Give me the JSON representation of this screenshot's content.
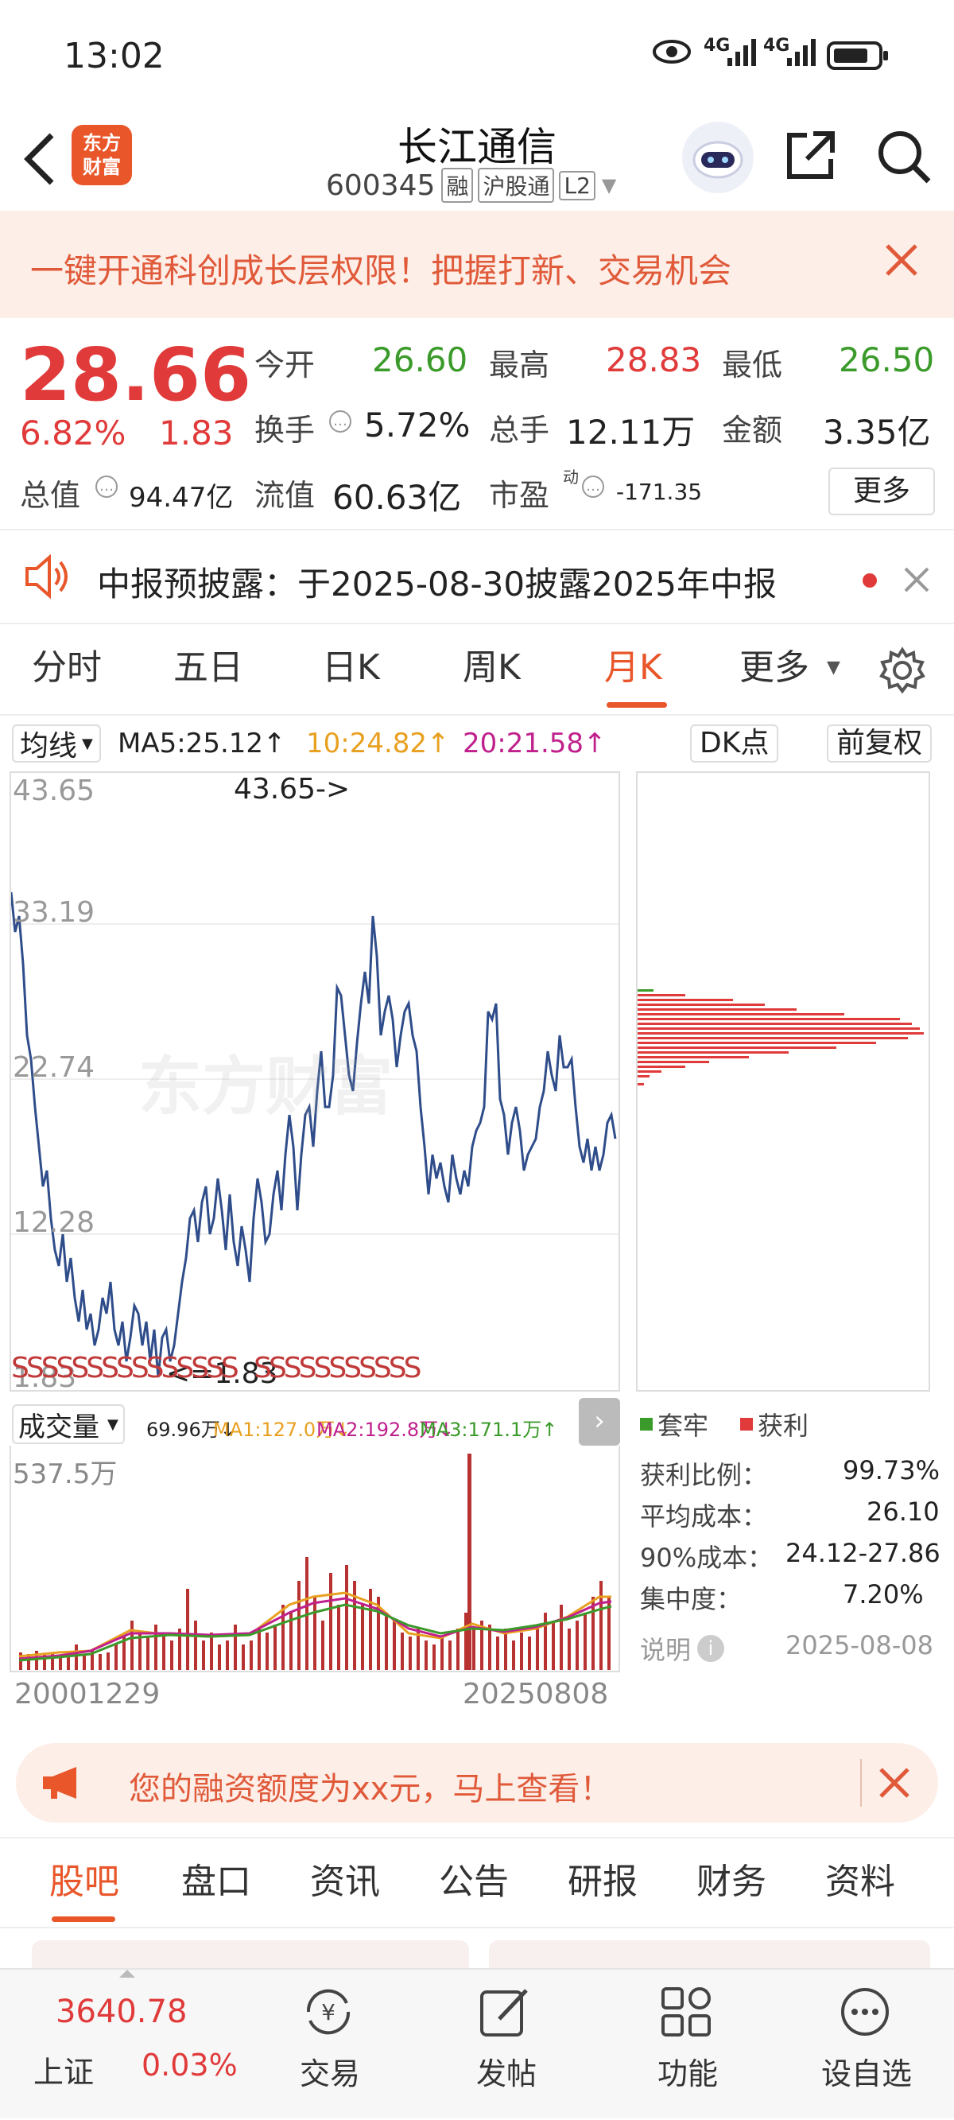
{
  "status": {
    "time": "13:02",
    "net1": "4G",
    "net2": "4G"
  },
  "header": {
    "logo_line1": "东方",
    "logo_line2": "财富",
    "title": "长江通信",
    "code": "600345",
    "badges": [
      "融",
      "沪股通",
      "L2"
    ]
  },
  "banner": {
    "text": "一键开通科创成长层权限！把握打新、交易机会"
  },
  "quote": {
    "price": "28.66",
    "change_pct": "6.82%",
    "change": "1.83",
    "open_label": "今开",
    "open": "26.60",
    "high_label": "最高",
    "high": "28.83",
    "low_label": "最低",
    "low": "26.50",
    "turnover_label": "换手",
    "turnover": "5.72%",
    "volume_label": "总手",
    "volume": "12.11万",
    "amount_label": "金额",
    "amount": "3.35亿",
    "mcap_label": "总值",
    "mcap": "94.47亿",
    "float_label": "流值",
    "float": "60.63亿",
    "pe_label": "市盈",
    "pe_sup": "动",
    "pe": "-171.35",
    "more": "更多"
  },
  "notice": {
    "text": "中报预披露：于2025-08-30披露2025年中报"
  },
  "tabs": [
    {
      "label": "分时"
    },
    {
      "label": "五日"
    },
    {
      "label": "日K"
    },
    {
      "label": "周K"
    },
    {
      "label": "月K"
    },
    {
      "label": "更多"
    }
  ],
  "chart_toolbar": {
    "ma_select": "均线",
    "ma5": "MA5:25.12↑",
    "ma10": "10:24.82↑",
    "ma20": "20:21.58↑",
    "dk": "DK点",
    "fq": "前复权"
  },
  "main_chart": {
    "y_ticks": [
      "43.65",
      "33.19",
      "22.74",
      "12.28",
      "1.83"
    ],
    "max_annotation": "43.65->",
    "min_annotation": "<=1.83",
    "s_markers": "SSSSSSSSSSSSSSS   SSSSSSSSSSS",
    "watermark": "东方财富"
  },
  "chip": {
    "legend_trap": "套牢",
    "legend_profit": "获利",
    "profit_ratio_label": "获利比例：",
    "profit_ratio": "99.73%",
    "avg_cost_label": "平均成本：",
    "avg_cost": "26.10",
    "cost90_label": "90%成本：",
    "cost90": "24.12-27.86",
    "concentration_label": "集中度：",
    "concentration": "7.20%",
    "note_label": "说明",
    "date": "2025-08-08"
  },
  "volume_bar": {
    "select": "成交量",
    "v": "69.96万↓",
    "ma1": "MA1:127.0万↓",
    "ma2": "MA2:192.8万↓",
    "ma3": "MA3:171.1万↑",
    "y_max": "537.5万",
    "start_date": "20001229",
    "end_date": "20250808"
  },
  "promo": {
    "text": "您的融资额度为xx元，马上查看！"
  },
  "bottom_tabs": [
    {
      "label": "股吧"
    },
    {
      "label": "盘口"
    },
    {
      "label": "资讯"
    },
    {
      "label": "公告"
    },
    {
      "label": "研报"
    },
    {
      "label": "财务"
    },
    {
      "label": "资料"
    }
  ],
  "footer": {
    "index_value": "3640.78",
    "index_name": "上证",
    "index_change": "0.03%",
    "items": [
      {
        "label": "交易"
      },
      {
        "label": "发帖"
      },
      {
        "label": "功能"
      },
      {
        "label": "设自选"
      }
    ]
  },
  "colors": {
    "accent": "#e8562a",
    "up": "#e03a3a",
    "down": "#3a9a2a",
    "line": "#2f4d8a"
  }
}
